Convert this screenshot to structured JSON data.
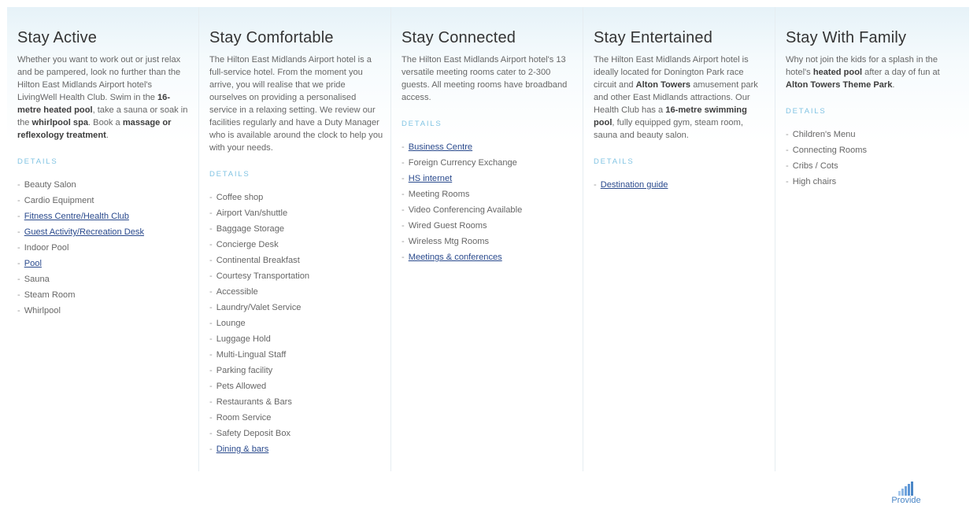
{
  "columns": [
    {
      "title": "Stay Active",
      "description": [
        {
          "t": "Whether you want to work out or just relax and be pampered, look no further than the Hilton East Midlands Airport hotel's LivingWell Health Club. Swim in the "
        },
        {
          "b": "16-metre heated pool"
        },
        {
          "t": ", take a sauna or soak in the "
        },
        {
          "b": "whirlpool spa"
        },
        {
          "t": ". Book a "
        },
        {
          "b": "massage or reflexology treatment"
        },
        {
          "t": "."
        }
      ],
      "details_label": "DETAILS",
      "items": [
        {
          "label": "Beauty Salon",
          "link": false
        },
        {
          "label": "Cardio Equipment",
          "link": false
        },
        {
          "label": "Fitness Centre/Health Club",
          "link": true
        },
        {
          "label": "Guest Activity/Recreation Desk",
          "link": true
        },
        {
          "label": "Indoor Pool",
          "link": false
        },
        {
          "label": "Pool",
          "link": true
        },
        {
          "label": "Sauna",
          "link": false
        },
        {
          "label": "Steam Room",
          "link": false
        },
        {
          "label": "Whirlpool",
          "link": false
        }
      ]
    },
    {
      "title": "Stay Comfortable",
      "description": [
        {
          "t": "The Hilton East Midlands Airport hotel is a full-service hotel. From the moment you arrive, you will realise that we pride ourselves on providing a personalised service in a relaxing setting. We review our facilities regularly and have a Duty Manager who is available around the clock to help you with your needs."
        }
      ],
      "details_label": "DETAILS",
      "items": [
        {
          "label": "Coffee shop",
          "link": false
        },
        {
          "label": "Airport Van/shuttle",
          "link": false
        },
        {
          "label": "Baggage Storage",
          "link": false
        },
        {
          "label": "Concierge Desk",
          "link": false
        },
        {
          "label": "Continental Breakfast",
          "link": false
        },
        {
          "label": "Courtesy Transportation",
          "link": false
        },
        {
          "label": "Accessible",
          "link": false
        },
        {
          "label": "Laundry/Valet Service",
          "link": false
        },
        {
          "label": "Lounge",
          "link": false
        },
        {
          "label": "Luggage Hold",
          "link": false
        },
        {
          "label": "Multi-Lingual Staff",
          "link": false
        },
        {
          "label": "Parking facility",
          "link": false
        },
        {
          "label": "Pets Allowed",
          "link": false
        },
        {
          "label": "Restaurants & Bars",
          "link": false
        },
        {
          "label": "Room Service",
          "link": false
        },
        {
          "label": "Safety Deposit Box",
          "link": false
        },
        {
          "label": "Dining & bars",
          "link": true
        }
      ]
    },
    {
      "title": "Stay Connected",
      "description": [
        {
          "t": "The Hilton East Midlands Airport hotel's 13 versatile meeting rooms cater to 2-300 guests. All meeting rooms have broadband access."
        }
      ],
      "details_label": "DETAILS",
      "items": [
        {
          "label": "Business Centre",
          "link": true
        },
        {
          "label": "Foreign Currency Exchange",
          "link": false
        },
        {
          "label": "HS internet",
          "link": true
        },
        {
          "label": "Meeting Rooms",
          "link": false
        },
        {
          "label": "Video Conferencing Available",
          "link": false
        },
        {
          "label": "Wired Guest Rooms",
          "link": false
        },
        {
          "label": "Wireless Mtg Rooms",
          "link": false
        },
        {
          "label": "Meetings & conferences",
          "link": true
        }
      ]
    },
    {
      "title": "Stay Entertained",
      "description": [
        {
          "t": "The Hilton East Midlands Airport hotel is ideally located for Donington Park race circuit and "
        },
        {
          "b": "Alton Towers"
        },
        {
          "t": " amusement park and other East Midlands attractions. Our Health Club has a "
        },
        {
          "b": "16-metre swimming pool"
        },
        {
          "t": ", fully equipped gym, steam room, sauna and beauty salon."
        }
      ],
      "details_label": "DETAILS",
      "items": [
        {
          "label": "Destination guide",
          "link": true
        }
      ]
    },
    {
      "title": "Stay With Family",
      "description": [
        {
          "t": "Why not join the kids for a splash in the hotel's "
        },
        {
          "b": "heated pool"
        },
        {
          "t": " after a day of fun at "
        },
        {
          "b": "Alton Towers Theme Park"
        },
        {
          "t": "."
        }
      ],
      "details_label": "DETAILS",
      "items": [
        {
          "label": "Children's Menu",
          "link": false
        },
        {
          "label": "Connecting Rooms",
          "link": false
        },
        {
          "label": "Cribs / Cots",
          "link": false
        },
        {
          "label": "High chairs",
          "link": false
        }
      ]
    }
  ],
  "footer": {
    "label": "Provide",
    "icon": "bar-chart-icon",
    "icon_color": "#5b95d6"
  },
  "colors": {
    "details_label": "#82c4e3",
    "link": "#2a4a8d",
    "title": "#333333"
  }
}
